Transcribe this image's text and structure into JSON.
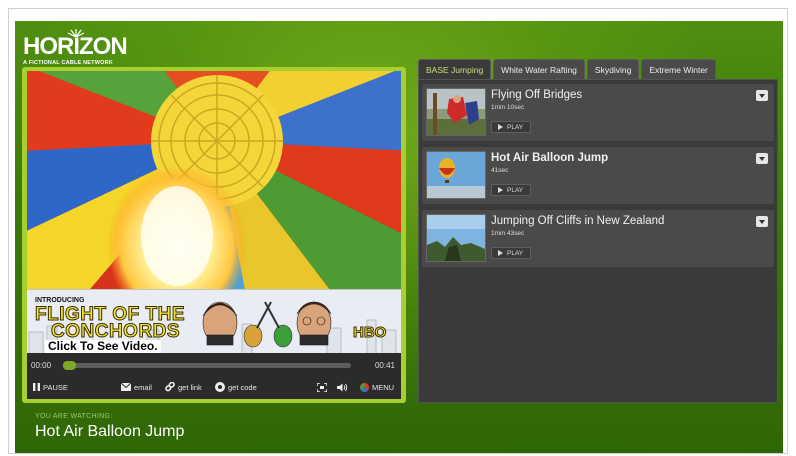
{
  "brand": {
    "name": "HORIZON",
    "tagline": "A FICTIONAL CABLE NETWORK"
  },
  "ad": {
    "intro": "INTRODUCING",
    "title_line1": "FLIGHT OF THE",
    "title_line2": "CONCHORDS",
    "network": "HBO",
    "cta": "Click To See Video."
  },
  "player": {
    "current_time": "00:00",
    "duration": "00:41",
    "progress": 0.0,
    "pause_label": "PAUSE",
    "email_label": "email",
    "get_link_label": "get link",
    "get_code_label": "get code",
    "menu_label": "MENU"
  },
  "now_watching": {
    "label": "YOU ARE WATCHING:",
    "title": "Hot Air Balloon Jump"
  },
  "tabs": [
    {
      "label": "BASE Jumping",
      "active": true
    },
    {
      "label": "White Water Rafting",
      "active": false
    },
    {
      "label": "Skydiving",
      "active": false
    },
    {
      "label": "Extreme Winter",
      "active": false
    }
  ],
  "videos": [
    {
      "title": "Flying Off Bridges",
      "duration": "1min 10sec",
      "play_label": "PLAY",
      "current": false
    },
    {
      "title": "Hot Air Balloon Jump",
      "duration": "41sec",
      "play_label": "PLAY",
      "current": true
    },
    {
      "title": "Jumping Off Cliffs in New Zealand",
      "duration": "1min 43sec",
      "play_label": "PLAY",
      "current": false
    }
  ],
  "colors": {
    "accent": "#a6cf2f",
    "background": "#3c7a0a",
    "panel": "#3a3a3a",
    "active_tab_text": "#c7e07a"
  }
}
